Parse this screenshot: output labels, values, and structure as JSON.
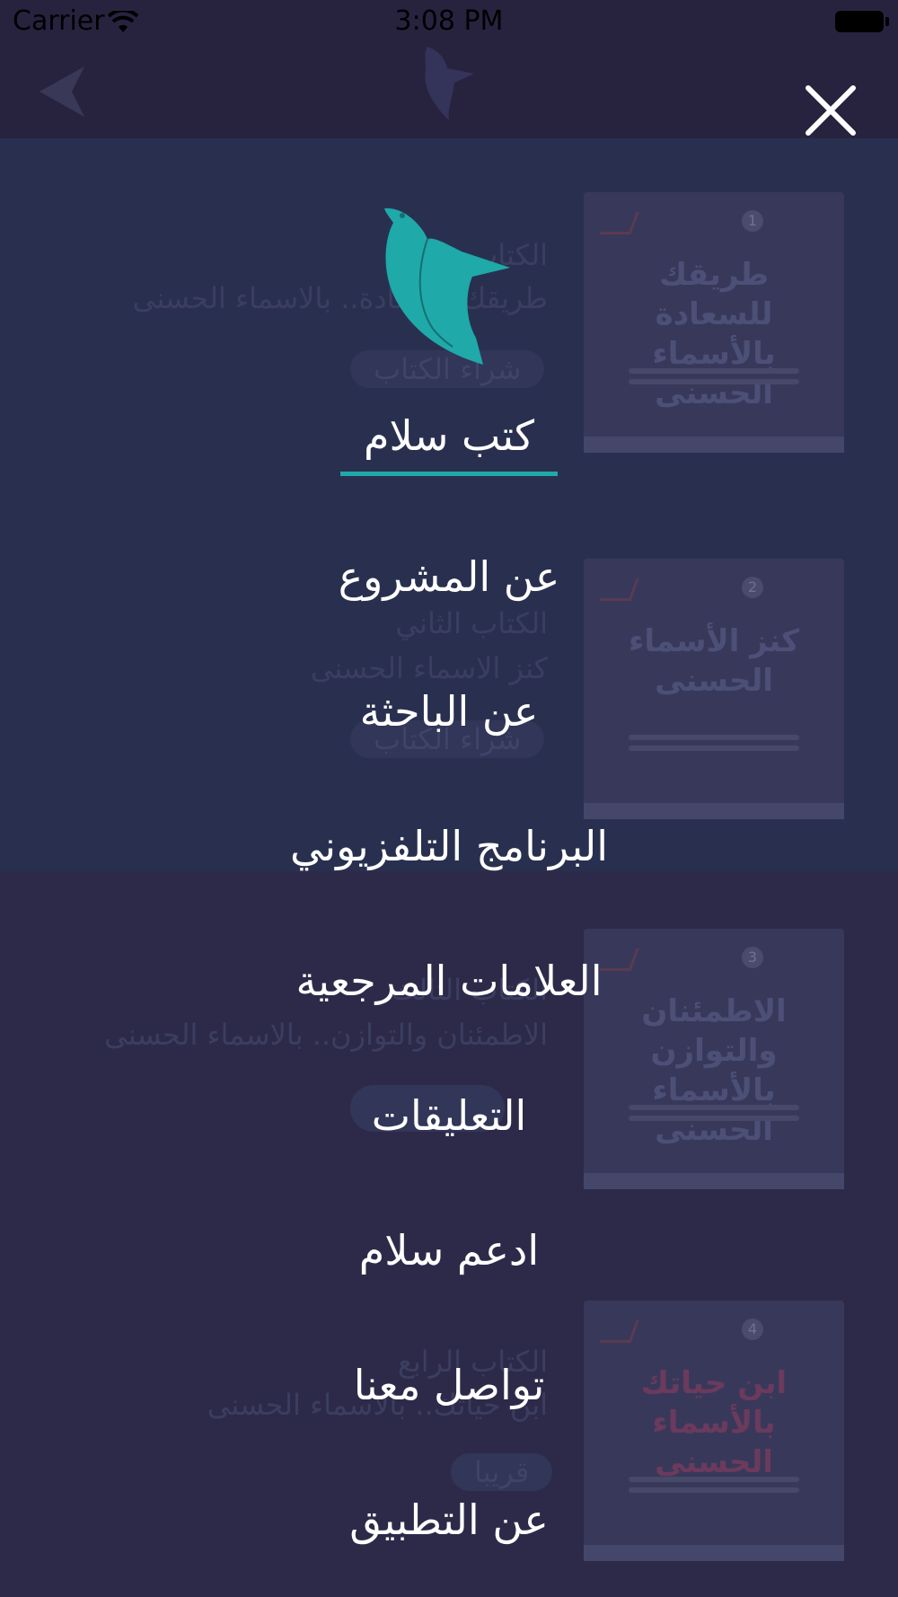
{
  "status_bar": {
    "carrier": "Carrier",
    "time": "3:08 PM"
  },
  "background": {
    "books": [
      {
        "heading": "الكتاب",
        "subtitle": "طريقك للسعادة.. بالاسماء الحسنى",
        "button": "شراء الكتاب",
        "cover_number": "1",
        "cover_title": "طريقك للسعادة بالأسماء الحسنى"
      },
      {
        "heading": "الكتاب الثاني",
        "subtitle": "كنز الاسماء الحسنى",
        "button": "شراء الكتاب",
        "cover_number": "2",
        "cover_title": "كنز الأسماء الحسنى"
      },
      {
        "heading": "الكتاب الثالث",
        "subtitle": "الاطمئنان والتوازن.. بالاسماء الحسنى",
        "button": "",
        "cover_number": "3",
        "cover_title": "الاطمئنان والتوازن بالأسماء الحسنى"
      },
      {
        "heading": "الكتاب الرابع",
        "subtitle": "ابن حياتك.. بالاسماء الحسنى",
        "button": "قريبا",
        "cover_number": "4",
        "cover_title": "ابن حياتك بالأسماء الحسنى"
      }
    ]
  },
  "menu": {
    "title": "كتب سلام",
    "items": [
      "عن المشروع",
      "عن الباحثة",
      "البرنامج التلفزيوني",
      "العلامات المرجعية",
      "التعليقات",
      "ادعم سلام",
      "تواصل معنا",
      "عن التطبيق"
    ]
  },
  "colors": {
    "accent": "#1fa9a9",
    "overlay": "#2b2848",
    "menu_text": "#ffffff"
  },
  "icons": {
    "close": "close-icon",
    "logo": "bird-logo-icon",
    "back": "back-arrow-icon"
  }
}
